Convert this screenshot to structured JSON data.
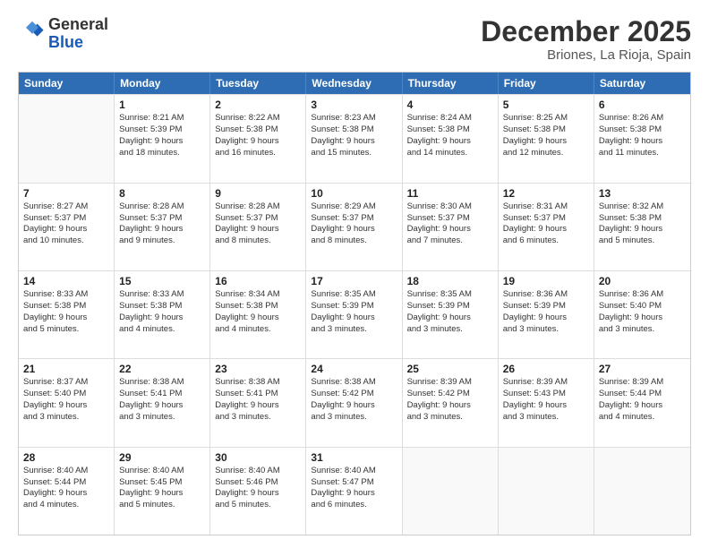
{
  "logo": {
    "line1": "General",
    "line2": "Blue"
  },
  "title": "December 2025",
  "subtitle": "Briones, La Rioja, Spain",
  "header": {
    "days": [
      "Sunday",
      "Monday",
      "Tuesday",
      "Wednesday",
      "Thursday",
      "Friday",
      "Saturday"
    ]
  },
  "rows": [
    [
      {
        "day": "",
        "lines": []
      },
      {
        "day": "1",
        "lines": [
          "Sunrise: 8:21 AM",
          "Sunset: 5:39 PM",
          "Daylight: 9 hours",
          "and 18 minutes."
        ]
      },
      {
        "day": "2",
        "lines": [
          "Sunrise: 8:22 AM",
          "Sunset: 5:38 PM",
          "Daylight: 9 hours",
          "and 16 minutes."
        ]
      },
      {
        "day": "3",
        "lines": [
          "Sunrise: 8:23 AM",
          "Sunset: 5:38 PM",
          "Daylight: 9 hours",
          "and 15 minutes."
        ]
      },
      {
        "day": "4",
        "lines": [
          "Sunrise: 8:24 AM",
          "Sunset: 5:38 PM",
          "Daylight: 9 hours",
          "and 14 minutes."
        ]
      },
      {
        "day": "5",
        "lines": [
          "Sunrise: 8:25 AM",
          "Sunset: 5:38 PM",
          "Daylight: 9 hours",
          "and 12 minutes."
        ]
      },
      {
        "day": "6",
        "lines": [
          "Sunrise: 8:26 AM",
          "Sunset: 5:38 PM",
          "Daylight: 9 hours",
          "and 11 minutes."
        ]
      }
    ],
    [
      {
        "day": "7",
        "lines": [
          "Sunrise: 8:27 AM",
          "Sunset: 5:37 PM",
          "Daylight: 9 hours",
          "and 10 minutes."
        ]
      },
      {
        "day": "8",
        "lines": [
          "Sunrise: 8:28 AM",
          "Sunset: 5:37 PM",
          "Daylight: 9 hours",
          "and 9 minutes."
        ]
      },
      {
        "day": "9",
        "lines": [
          "Sunrise: 8:28 AM",
          "Sunset: 5:37 PM",
          "Daylight: 9 hours",
          "and 8 minutes."
        ]
      },
      {
        "day": "10",
        "lines": [
          "Sunrise: 8:29 AM",
          "Sunset: 5:37 PM",
          "Daylight: 9 hours",
          "and 8 minutes."
        ]
      },
      {
        "day": "11",
        "lines": [
          "Sunrise: 8:30 AM",
          "Sunset: 5:37 PM",
          "Daylight: 9 hours",
          "and 7 minutes."
        ]
      },
      {
        "day": "12",
        "lines": [
          "Sunrise: 8:31 AM",
          "Sunset: 5:37 PM",
          "Daylight: 9 hours",
          "and 6 minutes."
        ]
      },
      {
        "day": "13",
        "lines": [
          "Sunrise: 8:32 AM",
          "Sunset: 5:38 PM",
          "Daylight: 9 hours",
          "and 5 minutes."
        ]
      }
    ],
    [
      {
        "day": "14",
        "lines": [
          "Sunrise: 8:33 AM",
          "Sunset: 5:38 PM",
          "Daylight: 9 hours",
          "and 5 minutes."
        ]
      },
      {
        "day": "15",
        "lines": [
          "Sunrise: 8:33 AM",
          "Sunset: 5:38 PM",
          "Daylight: 9 hours",
          "and 4 minutes."
        ]
      },
      {
        "day": "16",
        "lines": [
          "Sunrise: 8:34 AM",
          "Sunset: 5:38 PM",
          "Daylight: 9 hours",
          "and 4 minutes."
        ]
      },
      {
        "day": "17",
        "lines": [
          "Sunrise: 8:35 AM",
          "Sunset: 5:39 PM",
          "Daylight: 9 hours",
          "and 3 minutes."
        ]
      },
      {
        "day": "18",
        "lines": [
          "Sunrise: 8:35 AM",
          "Sunset: 5:39 PM",
          "Daylight: 9 hours",
          "and 3 minutes."
        ]
      },
      {
        "day": "19",
        "lines": [
          "Sunrise: 8:36 AM",
          "Sunset: 5:39 PM",
          "Daylight: 9 hours",
          "and 3 minutes."
        ]
      },
      {
        "day": "20",
        "lines": [
          "Sunrise: 8:36 AM",
          "Sunset: 5:40 PM",
          "Daylight: 9 hours",
          "and 3 minutes."
        ]
      }
    ],
    [
      {
        "day": "21",
        "lines": [
          "Sunrise: 8:37 AM",
          "Sunset: 5:40 PM",
          "Daylight: 9 hours",
          "and 3 minutes."
        ]
      },
      {
        "day": "22",
        "lines": [
          "Sunrise: 8:38 AM",
          "Sunset: 5:41 PM",
          "Daylight: 9 hours",
          "and 3 minutes."
        ]
      },
      {
        "day": "23",
        "lines": [
          "Sunrise: 8:38 AM",
          "Sunset: 5:41 PM",
          "Daylight: 9 hours",
          "and 3 minutes."
        ]
      },
      {
        "day": "24",
        "lines": [
          "Sunrise: 8:38 AM",
          "Sunset: 5:42 PM",
          "Daylight: 9 hours",
          "and 3 minutes."
        ]
      },
      {
        "day": "25",
        "lines": [
          "Sunrise: 8:39 AM",
          "Sunset: 5:42 PM",
          "Daylight: 9 hours",
          "and 3 minutes."
        ]
      },
      {
        "day": "26",
        "lines": [
          "Sunrise: 8:39 AM",
          "Sunset: 5:43 PM",
          "Daylight: 9 hours",
          "and 3 minutes."
        ]
      },
      {
        "day": "27",
        "lines": [
          "Sunrise: 8:39 AM",
          "Sunset: 5:44 PM",
          "Daylight: 9 hours",
          "and 4 minutes."
        ]
      }
    ],
    [
      {
        "day": "28",
        "lines": [
          "Sunrise: 8:40 AM",
          "Sunset: 5:44 PM",
          "Daylight: 9 hours",
          "and 4 minutes."
        ]
      },
      {
        "day": "29",
        "lines": [
          "Sunrise: 8:40 AM",
          "Sunset: 5:45 PM",
          "Daylight: 9 hours",
          "and 5 minutes."
        ]
      },
      {
        "day": "30",
        "lines": [
          "Sunrise: 8:40 AM",
          "Sunset: 5:46 PM",
          "Daylight: 9 hours",
          "and 5 minutes."
        ]
      },
      {
        "day": "31",
        "lines": [
          "Sunrise: 8:40 AM",
          "Sunset: 5:47 PM",
          "Daylight: 9 hours",
          "and 6 minutes."
        ]
      },
      {
        "day": "",
        "lines": []
      },
      {
        "day": "",
        "lines": []
      },
      {
        "day": "",
        "lines": []
      }
    ]
  ]
}
